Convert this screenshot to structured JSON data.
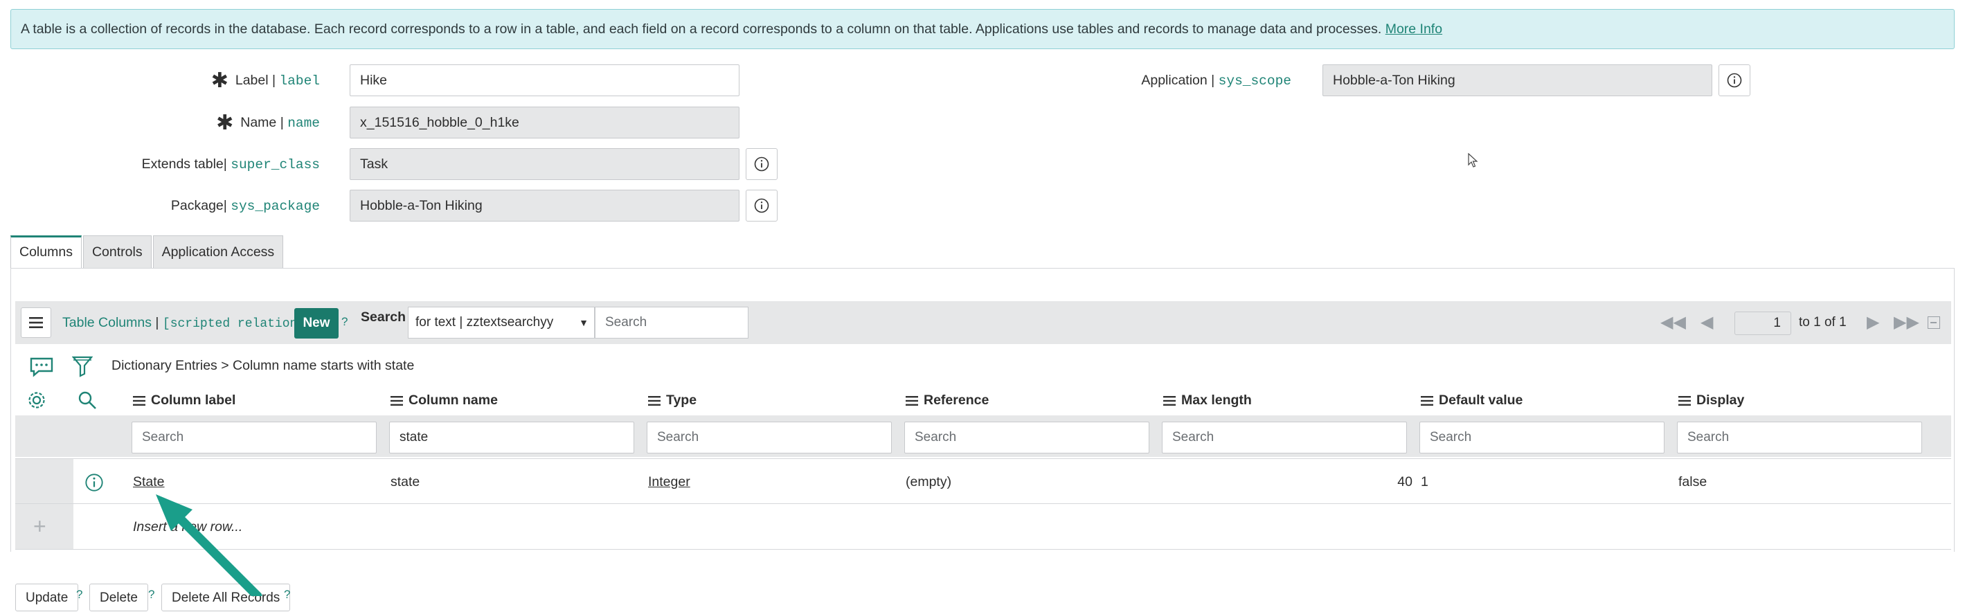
{
  "banner": {
    "text": "A table is a collection of records in the database. Each record corresponds to a row in a table, and each field on a record corresponds to a column on that table. Applications use tables and records to manage data and processes.",
    "link": "More Info"
  },
  "form": {
    "label": {
      "caption": "Label",
      "field": "label",
      "value": "Hike"
    },
    "name": {
      "caption": "Name",
      "field": "name",
      "value": "x_151516_hobble_0_h1ke"
    },
    "extends": {
      "caption": "Extends table",
      "field": "super_class",
      "value": "Task"
    },
    "package": {
      "caption": "Package",
      "field": "sys_package",
      "value": "Hobble-a-Ton Hiking"
    },
    "application": {
      "caption": "Application",
      "field": "sys_scope",
      "value": "Hobble-a-Ton Hiking"
    },
    "separator": "|",
    "required_mark": "✱"
  },
  "tabs": [
    "Columns",
    "Controls",
    "Application Access"
  ],
  "list": {
    "title": "Table Columns",
    "relation": "[scripted relation]",
    "new_label": "New",
    "help_mark": "?",
    "search_label": "Search",
    "search_field": "for text | zztextsearchyy",
    "search_placeholder": "Search",
    "page_value": "1",
    "page_info": "to 1 of 1",
    "breadcrumb_root": "Dictionary Entries",
    "breadcrumb_sep": ">",
    "breadcrumb_filter": "Column name starts with state",
    "columns": [
      "Column label",
      "Column name",
      "Type",
      "Reference",
      "Max length",
      "Default value",
      "Display"
    ],
    "column_search": [
      "Search",
      "state",
      "Search",
      "Search",
      "Search",
      "Search",
      "Search"
    ],
    "row": {
      "column_label": "State",
      "column_name": "state",
      "type": "Integer",
      "reference": "(empty)",
      "max_length": "40",
      "default_value": "1",
      "display": "false"
    },
    "insert_label": "Insert a new row..."
  },
  "bottom_buttons": [
    "Update",
    "Delete",
    "Delete All Records"
  ],
  "colors": {
    "accent": "#1f8476",
    "button": "#1a7a6b",
    "banner_bg": "#d9f1f3",
    "arrow": "#1a9e8a"
  }
}
